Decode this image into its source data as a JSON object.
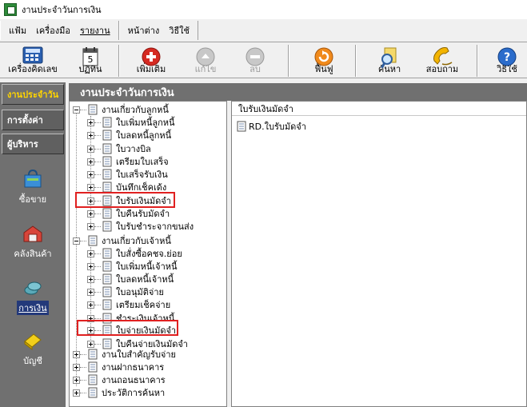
{
  "window": {
    "title": "งานประจำวันการเงิน"
  },
  "menu": {
    "group1": [
      "แฟ้ม",
      "เครื่องมือ",
      "รายงาน"
    ],
    "group2": [
      "หน้าต่าง",
      "วิธีใช้"
    ]
  },
  "toolbar": {
    "calculator": "เครื่องคิดเลข",
    "calendar": "ปฏิทิน",
    "add": "เพิ่มเติม",
    "edit": "แก้ไข",
    "delete": "ลบ",
    "restore": "ฟื้นฟู",
    "search": "ค้นหา",
    "inquiry": "สอบถาม",
    "help": "วิธีใช้"
  },
  "sidebar": {
    "tabs": [
      "งานประจำวัน",
      "การตั้งค่า",
      "ผู้บริหาร"
    ],
    "items": [
      "ซื้อขาย",
      "คลังสินค้า",
      "การเงิน",
      "บัญชี"
    ]
  },
  "main": {
    "header": "งานประจำวันการเงิน"
  },
  "tree": {
    "nodes": [
      "งานเกี่ยวกับลูกหนี้",
      "ใบเพิ่มหนี้ลูกหนี้",
      "ใบลดหนี้ลูกหนี้",
      "ใบวางบิล",
      "เตรียมใบเสร็จ",
      "ใบเสร็จรับเงิน",
      "บันทึกเช็คเด้ง",
      "ใบรับเงินมัดจำ",
      "ใบคืนรับมัดจำ",
      "ใบรับชำระจากขนส่ง",
      "งานเกี่ยวกับเจ้าหนี้",
      "ใบสั่งซื้อคชจ.ย่อย",
      "ใบเพิ่มหนี้เจ้าหนี้",
      "ใบลดหนี้เจ้าหนี้",
      "ใบอนุมัติจ่าย",
      "เตรียมเช็คจ่าย",
      "ชำระเงินเจ้าหนี้",
      "ใบจ่ายเงินมัดจำ",
      "ใบคืนจ่ายเงินมัดจำ",
      "งานใบสำคัญรับจ่าย",
      "งานฝากธนาคาร",
      "งานถอนธนาคาร",
      "ประวัติการค้นหา"
    ]
  },
  "detail": {
    "header": "ใบรับเงินมัดจำ",
    "files": [
      "RD.ใบรับมัดจำ"
    ]
  },
  "colors": {
    "highlight": "#e02020",
    "panel": "#707070",
    "active_tab": "#ffd400"
  }
}
